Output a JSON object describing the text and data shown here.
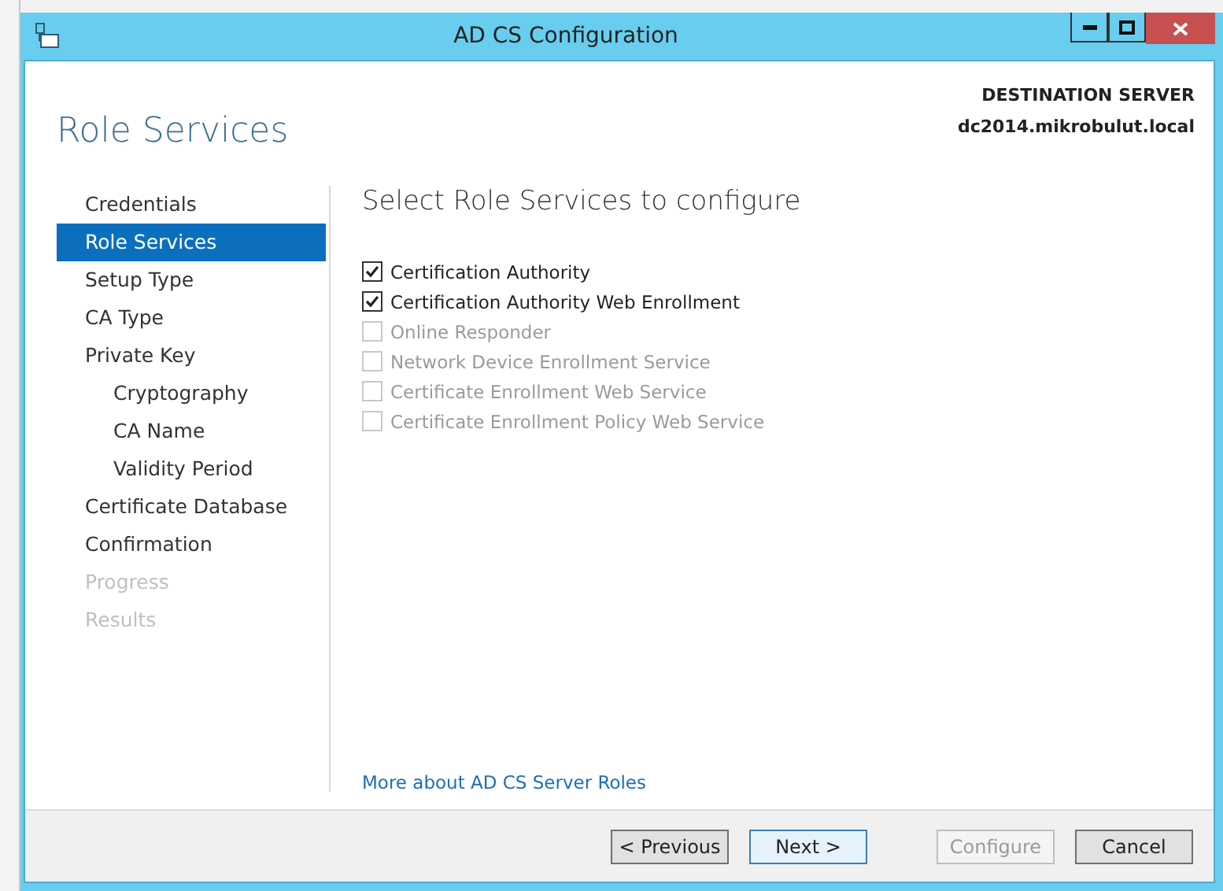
{
  "window": {
    "title": "AD CS Configuration"
  },
  "header": {
    "page_title": "Role Services",
    "server_label": "DESTINATION SERVER",
    "server_name": "dc2014.mikrobulut.local"
  },
  "nav": [
    {
      "label": "Credentials",
      "selected": false,
      "disabled": false
    },
    {
      "label": "Role Services",
      "selected": true,
      "disabled": false
    },
    {
      "label": "Setup Type",
      "selected": false,
      "disabled": false
    },
    {
      "label": "CA Type",
      "selected": false,
      "disabled": false
    },
    {
      "label": "Private Key",
      "selected": false,
      "disabled": false,
      "children": [
        {
          "label": "Cryptography",
          "selected": false,
          "disabled": false
        },
        {
          "label": "CA Name",
          "selected": false,
          "disabled": false
        },
        {
          "label": "Validity Period",
          "selected": false,
          "disabled": false
        }
      ]
    },
    {
      "label": "Certificate Database",
      "selected": false,
      "disabled": false
    },
    {
      "label": "Confirmation",
      "selected": false,
      "disabled": false
    },
    {
      "label": "Progress",
      "selected": false,
      "disabled": true
    },
    {
      "label": "Results",
      "selected": false,
      "disabled": true
    }
  ],
  "content": {
    "heading": "Select Role Services to configure",
    "roles": [
      {
        "label": "Certification Authority",
        "checked": true,
        "disabled": false
      },
      {
        "label": "Certification Authority Web Enrollment",
        "checked": true,
        "disabled": false
      },
      {
        "label": "Online Responder",
        "checked": false,
        "disabled": true
      },
      {
        "label": "Network Device Enrollment Service",
        "checked": false,
        "disabled": true
      },
      {
        "label": "Certificate Enrollment Web Service",
        "checked": false,
        "disabled": true
      },
      {
        "label": "Certificate Enrollment Policy Web Service",
        "checked": false,
        "disabled": true
      }
    ],
    "link": "More about AD CS Server Roles"
  },
  "buttons": [
    {
      "label": "< Previous",
      "disabled": false,
      "focused": false
    },
    {
      "label": "Next >",
      "disabled": false,
      "focused": true
    },
    {
      "label": "Configure",
      "disabled": true,
      "focused": false
    },
    {
      "label": "Cancel",
      "disabled": false,
      "focused": false
    }
  ]
}
